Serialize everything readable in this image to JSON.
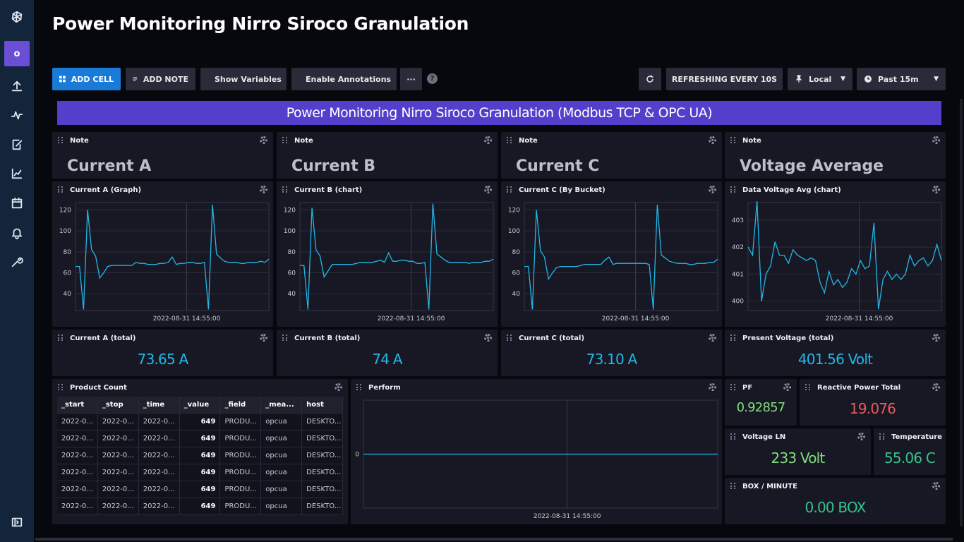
{
  "sidebar": {
    "org_initial": "o",
    "items": [
      "influx-logo-icon",
      "upload-icon",
      "pulse-icon",
      "edit-icon",
      "graph-icon",
      "calendar-icon",
      "bell-icon",
      "wrench-icon",
      "collapse-icon"
    ]
  },
  "page": {
    "title": "Power Monitoring Nirro Siroco Granulation"
  },
  "toolbar": {
    "add_cell": "ADD CELL",
    "add_note": "ADD NOTE",
    "show_variables": "Show Variables",
    "enable_annotations": "Enable Annotations",
    "more": "···",
    "help": "?",
    "refresh_label": "REFRESHING EVERY 10S",
    "timezone": "Local",
    "time_range": "Past 15m"
  },
  "banner": {
    "text": "Power Monitoring Nirro Siroco Granulation (Modbus TCP & OPC UA)"
  },
  "notes": [
    {
      "title": "Note",
      "text": "Current A"
    },
    {
      "title": "Note",
      "text": "Current B"
    },
    {
      "title": "Note",
      "text": "Current C"
    },
    {
      "title": "Note",
      "text": "Voltage Average"
    }
  ],
  "graph_titles": [
    "Current A (Graph)",
    "Current B (chart)",
    "Current C (By Bucket)",
    "Data Voltage Avg (chart)"
  ],
  "x_tick_label": "2022-08-31 14:55:00",
  "single_stats": {
    "current_a": {
      "title": "Current A (total)",
      "value": "73.65 A"
    },
    "current_b": {
      "title": "Current B (total)",
      "value": "74 A"
    },
    "current_c": {
      "title": "Current C (total)",
      "value": "73.10 A"
    },
    "present_voltage": {
      "title": "Present Voltage (total)",
      "value": "401.56 Volt"
    },
    "pf": {
      "title": "PF",
      "value": "0.92857"
    },
    "reactive": {
      "title": "Reactive Power Total",
      "value": "19.076"
    },
    "voltage_ln": {
      "title": "Voltage LN",
      "value": "233 Volt"
    },
    "temperature": {
      "title": "Temperature",
      "value": "55.06 C"
    },
    "box_minute": {
      "title": "BOX / MINUTE",
      "value": "0.00 BOX"
    }
  },
  "product_count": {
    "title": "Product Count",
    "columns": [
      "_start",
      "_stop",
      "_time",
      "_value",
      "_field",
      "_mea...",
      "host"
    ],
    "rows": [
      [
        "2022-0...",
        "2022-0...",
        "2022-0...",
        "649",
        "PRODU...",
        "opcua",
        "DESKTO..."
      ],
      [
        "2022-0...",
        "2022-0...",
        "2022-0...",
        "649",
        "PRODU...",
        "opcua",
        "DESKTO..."
      ],
      [
        "2022-0...",
        "2022-0...",
        "2022-0...",
        "649",
        "PRODU...",
        "opcua",
        "DESKTO..."
      ],
      [
        "2022-0...",
        "2022-0...",
        "2022-0...",
        "649",
        "PRODU...",
        "opcua",
        "DESKTO..."
      ],
      [
        "2022-0...",
        "2022-0...",
        "2022-0...",
        "649",
        "PRODU...",
        "opcua",
        "DESKTO..."
      ],
      [
        "2022-0...",
        "2022-0...",
        "2022-0...",
        "649",
        "PRODU...",
        "opcua",
        "DESKTO..."
      ]
    ]
  },
  "perform": {
    "title": "Perform",
    "y_tick": "0"
  },
  "colors": {
    "accent": "#1a7ad8",
    "banner": "#523fcc",
    "series": "#22b7e8",
    "green": "#7ee07a",
    "red": "#e85a60",
    "teal": "#35c48f"
  },
  "chart_data": [
    {
      "type": "line",
      "title": "Current A (Graph)",
      "y_ticks": [
        40,
        60,
        80,
        100,
        120
      ],
      "ylim": [
        24,
        127
      ],
      "x_ticks": [
        "2022-08-31 14:55:00"
      ],
      "values": [
        66,
        66,
        25,
        120,
        82,
        76,
        55,
        60,
        66,
        67,
        67,
        67,
        67,
        67,
        67,
        70,
        69,
        69,
        68,
        68,
        68,
        69,
        69,
        70,
        75,
        68,
        69,
        69,
        70,
        70,
        69,
        69,
        70,
        25,
        125,
        78,
        74,
        71,
        70,
        70,
        70,
        69,
        69,
        70,
        70,
        70,
        71,
        70,
        73
      ]
    },
    {
      "type": "line",
      "title": "Current B (chart)",
      "y_ticks": [
        40,
        60,
        80,
        100,
        120
      ],
      "ylim": [
        24,
        127
      ],
      "x_ticks": [
        "2022-08-31 14:55:00"
      ],
      "values": [
        67,
        67,
        25,
        122,
        82,
        76,
        56,
        62,
        68,
        68,
        68,
        68,
        68,
        68,
        69,
        70,
        70,
        70,
        70,
        71,
        72,
        70,
        79,
        71,
        71,
        72,
        72,
        71,
        71,
        69,
        69,
        70,
        25,
        126,
        78,
        75,
        72,
        70,
        70,
        70,
        70,
        70,
        69,
        70,
        70,
        70,
        71,
        71,
        73
      ]
    },
    {
      "type": "line",
      "title": "Current C (By Bucket)",
      "y_ticks": [
        40,
        60,
        80,
        100,
        120
      ],
      "ylim": [
        24,
        127
      ],
      "x_ticks": [
        "2022-08-31 14:55:00"
      ],
      "values": [
        66,
        66,
        25,
        120,
        81,
        75,
        54,
        60,
        65,
        66,
        66,
        66,
        66,
        66,
        67,
        68,
        68,
        68,
        68,
        68,
        72,
        75,
        68,
        69,
        69,
        69,
        69,
        69,
        69,
        69,
        69,
        68,
        25,
        125,
        77,
        74,
        71,
        70,
        69,
        69,
        69,
        68,
        68,
        69,
        69,
        69,
        70,
        70,
        73
      ]
    },
    {
      "type": "line",
      "title": "Data Voltage Avg (chart)",
      "y_ticks": [
        400,
        401,
        402,
        403
      ],
      "ylim": [
        399.65,
        403.65
      ],
      "x_ticks": [
        "2022-08-31 14:55:00"
      ],
      "values": [
        402.0,
        401.7,
        403.7,
        400.0,
        401.0,
        401.3,
        402.2,
        401.7,
        401.7,
        401.4,
        401.9,
        401.7,
        401.6,
        401.5,
        401.6,
        401.5,
        400.7,
        400.3,
        401.1,
        400.6,
        400.8,
        400.5,
        400.7,
        401.2,
        401.0,
        401.5,
        401.2,
        401.3,
        402.9,
        399.7,
        400.8,
        401.1,
        400.8,
        401.0,
        400.8,
        401.0,
        401.7,
        401.3,
        401.5,
        401.6,
        401.3,
        401.5,
        402.1,
        401.5
      ]
    },
    {
      "type": "line",
      "title": "Perform",
      "y_ticks": [
        0
      ],
      "x_ticks": [
        "2022-08-31 14:55:00"
      ],
      "values": [
        0,
        0
      ]
    }
  ]
}
